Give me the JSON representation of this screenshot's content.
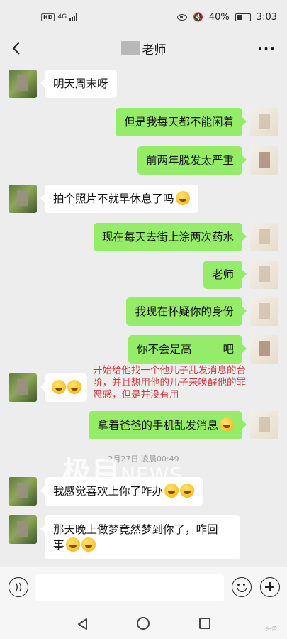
{
  "status_bar": {
    "hd": "HD",
    "network": "4G",
    "battery_percent": "40%",
    "battery_level": 0.4,
    "time": "3:03"
  },
  "header": {
    "title": "老师"
  },
  "messages": [
    {
      "side": "left",
      "text": "明天周末呀"
    },
    {
      "side": "right",
      "text": "但是我每天都不能闲着"
    },
    {
      "side": "right",
      "text": "前两年脱发太严重"
    },
    {
      "side": "left",
      "text": "拍个照片不就早休息了吗"
    },
    {
      "side": "right",
      "text": "现在每天去街上涂两次药水"
    },
    {
      "side": "right",
      "text": "老师"
    },
    {
      "side": "right",
      "text": "我现在怀疑你的身份"
    },
    {
      "side": "right",
      "text_a": "你不会是高",
      "text_b": "吧"
    },
    {
      "side": "left",
      "text": ""
    },
    {
      "side": "right",
      "text": "拿着爸爸的手机乱发消息"
    },
    {
      "side": "left",
      "text": "我感觉喜欢上你了咋办"
    },
    {
      "side": "left",
      "text_line1": "那天晚上做梦竟然梦到你了，咋回",
      "text_line2": "事"
    }
  ],
  "annotation": "开始给他找一个他儿子乱发消息的台阶，并且想用他的儿子来唤醒他的罪恶感，但是并没有用",
  "timestamp": "2月27日 凌晨00:49",
  "watermark": {
    "cn": "极目",
    "en": "NEWS"
  },
  "corner_mark": "头条",
  "colors": {
    "sent_bubble": "#95ec69",
    "received_bubble": "#ffffff",
    "background": "#ededed",
    "annotation": "#d0393b"
  },
  "icons": [
    "back-arrow-icon",
    "more-icon",
    "voice-icon",
    "emoji-icon",
    "plus-icon",
    "nav-back-icon",
    "nav-home-icon",
    "nav-recent-icon"
  ]
}
